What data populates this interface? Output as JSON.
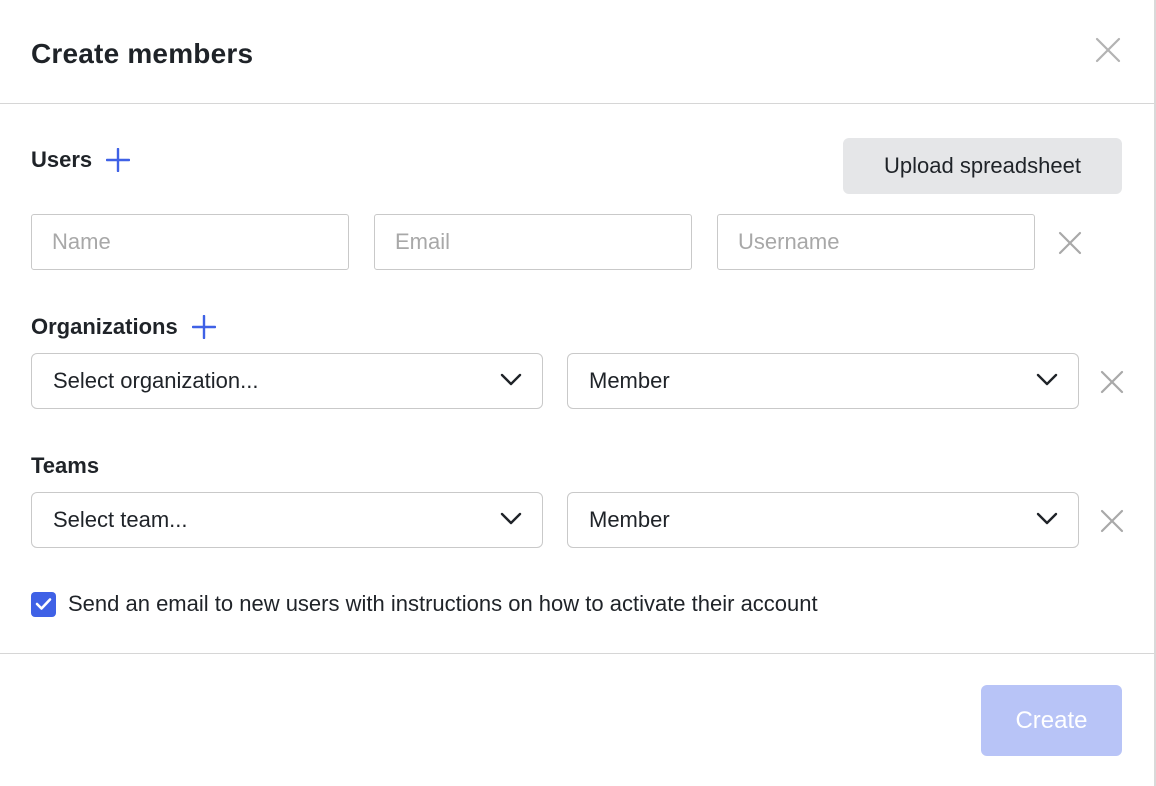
{
  "dialog": {
    "title": "Create members",
    "close_icon": "close-icon"
  },
  "users": {
    "label": "Users",
    "add_icon": "plus-icon",
    "upload_label": "Upload spreadsheet",
    "name_placeholder": "Name",
    "email_placeholder": "Email",
    "username_placeholder": "Username",
    "name_value": "",
    "email_value": "",
    "username_value": ""
  },
  "organizations": {
    "label": "Organizations",
    "add_icon": "plus-icon",
    "select_value": "Select organization...",
    "role_value": "Member"
  },
  "teams": {
    "label": "Teams",
    "select_value": "Select team...",
    "role_value": "Member"
  },
  "notify": {
    "checked": true,
    "label": "Send an email to new users with instructions on how to activate their account"
  },
  "footer": {
    "create_label": "Create",
    "create_enabled": false
  },
  "colors": {
    "accent": "#3f61e6",
    "create_disabled_bg": "#b8c4f7",
    "upload_bg": "#e5e6e8",
    "border": "#c9c9c9",
    "placeholder": "#a8a8a8"
  }
}
